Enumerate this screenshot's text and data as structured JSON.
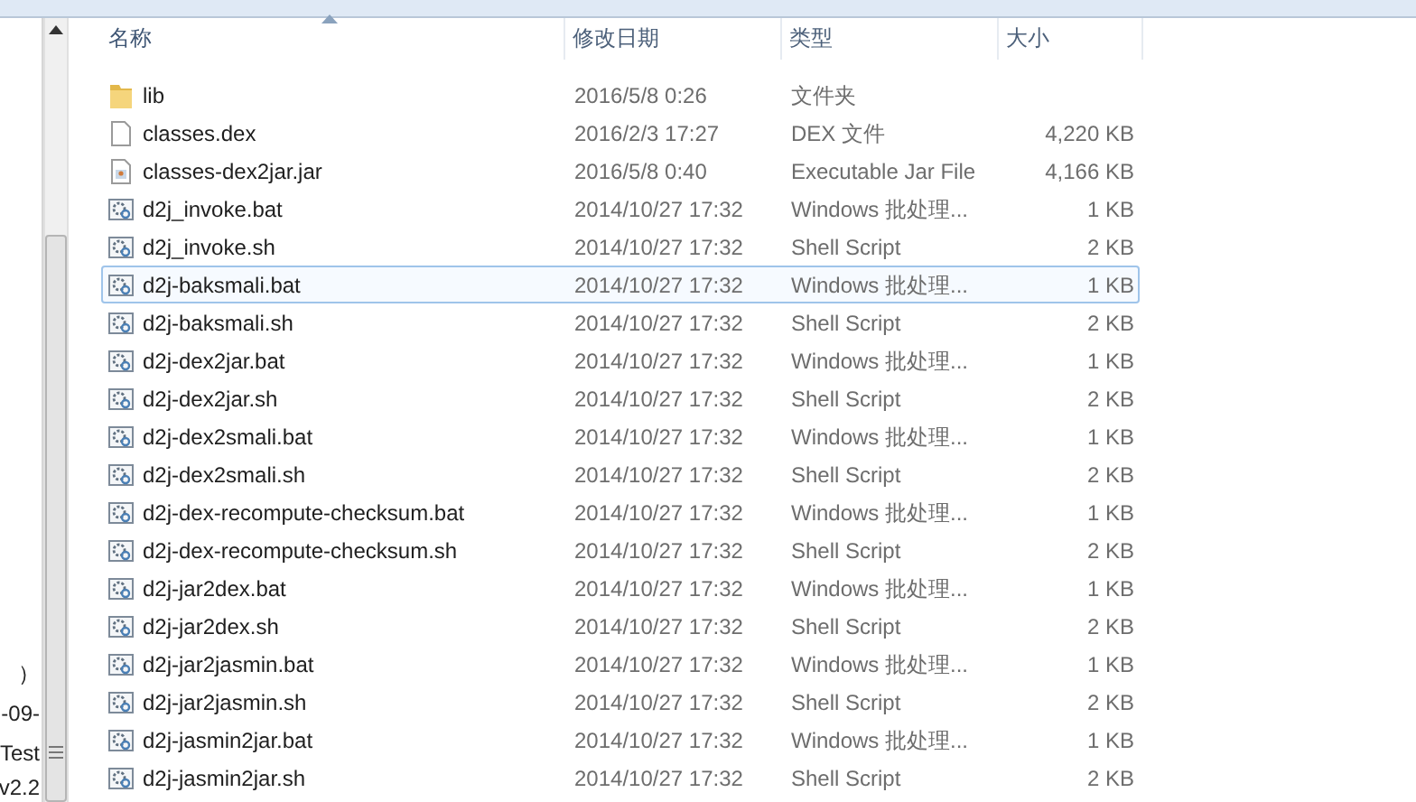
{
  "navigation_pane": {
    "items": [
      "）",
      "-09-",
      "Test",
      "v2.2"
    ]
  },
  "columns": [
    {
      "label": "名称",
      "sorted": true
    },
    {
      "label": "修改日期",
      "sorted": false
    },
    {
      "label": "类型",
      "sorted": false
    },
    {
      "label": "大小",
      "sorted": false
    }
  ],
  "files": [
    {
      "kind": "folder",
      "name": "lib",
      "modified": "2016/5/8 0:26",
      "type": "文件夹",
      "highlighted": false
    },
    {
      "kind": "file",
      "name": "classes.dex",
      "modified": "2016/2/3 17:27",
      "type": "DEX 文件",
      "size": "4,220 KB",
      "highlighted": false
    },
    {
      "kind": "jar",
      "name": "classes-dex2jar.jar",
      "modified": "2016/5/8 0:40",
      "type": "Executable Jar File",
      "size": "4,166 KB",
      "highlighted": false
    },
    {
      "kind": "script",
      "name": "d2j_invoke.bat",
      "modified": "2014/10/27 17:32",
      "type": "Windows 批处理...",
      "size": "1 KB",
      "highlighted": false
    },
    {
      "kind": "script",
      "name": "d2j_invoke.sh",
      "modified": "2014/10/27 17:32",
      "type": "Shell Script",
      "size": "2 KB",
      "highlighted": false
    },
    {
      "kind": "script",
      "name": "d2j-baksmali.bat",
      "modified": "2014/10/27 17:32",
      "type": "Windows 批处理...",
      "size": "1 KB",
      "highlighted": true
    },
    {
      "kind": "script",
      "name": "d2j-baksmali.sh",
      "modified": "2014/10/27 17:32",
      "type": "Shell Script",
      "size": "2 KB",
      "highlighted": false
    },
    {
      "kind": "script",
      "name": "d2j-dex2jar.bat",
      "modified": "2014/10/27 17:32",
      "type": "Windows 批处理...",
      "size": "1 KB",
      "highlighted": false
    },
    {
      "kind": "script",
      "name": "d2j-dex2jar.sh",
      "modified": "2014/10/27 17:32",
      "type": "Shell Script",
      "size": "2 KB",
      "highlighted": false
    },
    {
      "kind": "script",
      "name": "d2j-dex2smali.bat",
      "modified": "2014/10/27 17:32",
      "type": "Windows 批处理...",
      "size": "1 KB",
      "highlighted": false
    },
    {
      "kind": "script",
      "name": "d2j-dex2smali.sh",
      "modified": "2014/10/27 17:32",
      "type": "Shell Script",
      "size": "2 KB",
      "highlighted": false
    },
    {
      "kind": "script",
      "name": "d2j-dex-recompute-checksum.bat",
      "modified": "2014/10/27 17:32",
      "type": "Windows 批处理...",
      "size": "1 KB",
      "highlighted": false
    },
    {
      "kind": "script",
      "name": "d2j-dex-recompute-checksum.sh",
      "modified": "2014/10/27 17:32",
      "type": "Shell Script",
      "size": "2 KB",
      "highlighted": false
    },
    {
      "kind": "script",
      "name": "d2j-jar2dex.bat",
      "modified": "2014/10/27 17:32",
      "type": "Windows 批处理...",
      "size": "1 KB",
      "highlighted": false
    },
    {
      "kind": "script",
      "name": "d2j-jar2dex.sh",
      "modified": "2014/10/27 17:32",
      "type": "Shell Script",
      "size": "2 KB",
      "highlighted": false
    },
    {
      "kind": "script",
      "name": "d2j-jar2jasmin.bat",
      "modified": "2014/10/27 17:32",
      "type": "Windows 批处理...",
      "size": "1 KB",
      "highlighted": false
    },
    {
      "kind": "script",
      "name": "d2j-jar2jasmin.sh",
      "modified": "2014/10/27 17:32",
      "type": "Shell Script",
      "size": "2 KB",
      "highlighted": false
    },
    {
      "kind": "script",
      "name": "d2j-jasmin2jar.bat",
      "modified": "2014/10/27 17:32",
      "type": "Windows 批处理...",
      "size": "1 KB",
      "highlighted": false
    },
    {
      "kind": "script",
      "name": "d2j-jasmin2jar.sh",
      "modified": "2014/10/27 17:32",
      "type": "Shell Script",
      "size": "2 KB",
      "highlighted": false
    }
  ]
}
